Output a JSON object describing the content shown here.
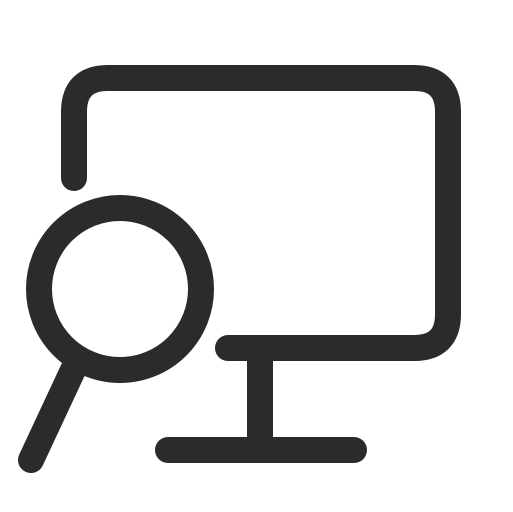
{
  "icon": {
    "name": "monitor-search-icon",
    "stroke_color": "#2b2b2b",
    "background": "#ffffff"
  }
}
